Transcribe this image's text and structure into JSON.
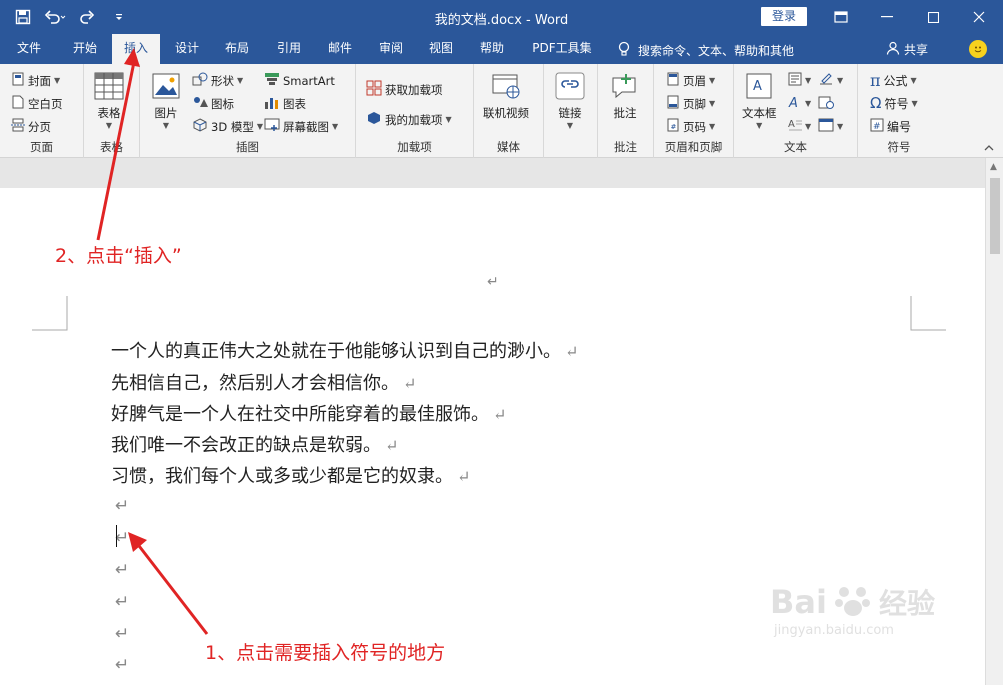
{
  "window": {
    "title": "我的文档.docx  -  Word",
    "login": "登录"
  },
  "tabs": [
    {
      "label": "文件"
    },
    {
      "label": "开始"
    },
    {
      "label": "插入"
    },
    {
      "label": "设计"
    },
    {
      "label": "布局"
    },
    {
      "label": "引用"
    },
    {
      "label": "邮件"
    },
    {
      "label": "审阅"
    },
    {
      "label": "视图"
    },
    {
      "label": "帮助"
    },
    {
      "label": "PDF工具集"
    }
  ],
  "tell_me": "搜索命令、文本、帮助和其他",
  "share": "共享",
  "ribbon": {
    "page": {
      "label": "页面",
      "cover": "封面",
      "blank": "空白页",
      "break": "分页"
    },
    "table": {
      "label": "表格",
      "btn": "表格"
    },
    "illus": {
      "label": "插图",
      "picture": "图片",
      "shapes": "形状",
      "icons": "图标",
      "model3d": "3D 模型",
      "smartart": "SmartArt",
      "chart": "图表",
      "screenshot": "屏幕截图"
    },
    "addins": {
      "label": "加载项",
      "get": "获取加载项",
      "my": "我的加载项"
    },
    "media": {
      "label": "媒体",
      "video": "联机视频"
    },
    "links": {
      "label": "",
      "link": "链接"
    },
    "comments": {
      "label": "批注",
      "comment": "批注"
    },
    "headerfooter": {
      "label": "页眉和页脚",
      "header": "页眉",
      "footer": "页脚",
      "pagenum": "页码"
    },
    "text": {
      "label": "文本",
      "textbox": "文本框"
    },
    "symbols": {
      "label": "符号",
      "equation": "公式",
      "symbol": "符号",
      "number": "编号"
    }
  },
  "doc": {
    "lines": [
      "一个人的真正伟大之处就在于他能够认识到自己的渺小。",
      "先相信自己，然后别人才会相信你。",
      "好脾气是一个人在社交中所能穿着的最佳服饰。",
      "我们唯一不会改正的缺点是软弱。",
      "习惯，我们每个人或多或少都是它的奴隶。"
    ],
    "para_mark": "↵"
  },
  "annotations": {
    "step1": "1、点击需要插入符号的地方",
    "step2": "2、点击“插入”"
  },
  "watermark": {
    "brand": "Bai",
    "brand2": "经验",
    "url": "jingyan.baidu.com"
  },
  "colors": {
    "accent": "#2b579a",
    "annotation": "#e02424"
  }
}
